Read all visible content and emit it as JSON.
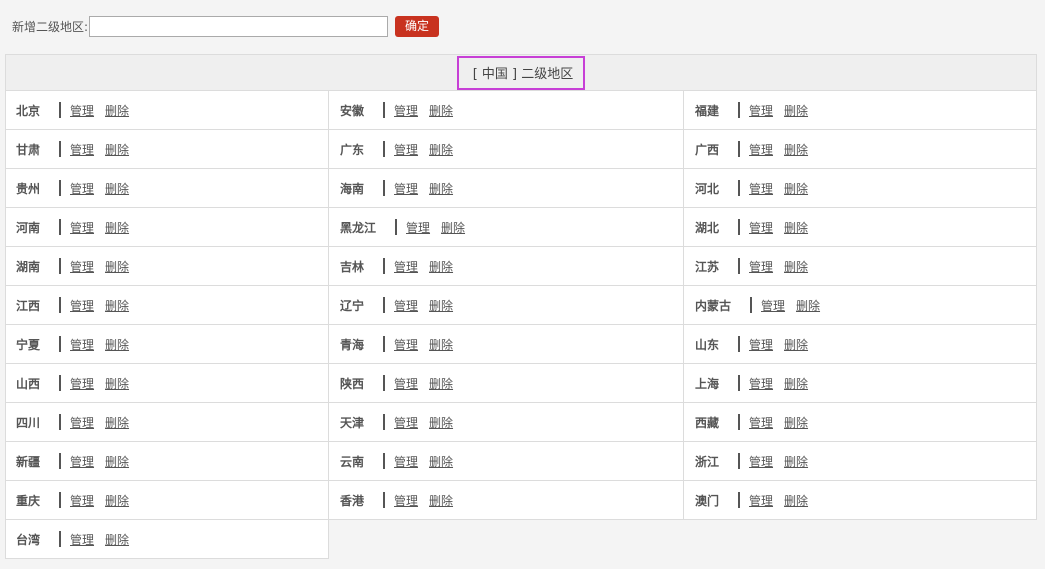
{
  "add_bar": {
    "label": "新增二级地区:",
    "input_value": "",
    "input_placeholder": "",
    "confirm_label": "确定"
  },
  "table": {
    "header": "[ 中国 ] 二级地区",
    "manage_label": "管理",
    "delete_label": "删除",
    "regions": [
      "北京",
      "安徽",
      "福建",
      "甘肃",
      "广东",
      "广西",
      "贵州",
      "海南",
      "河北",
      "河南",
      "黑龙江",
      "湖北",
      "湖南",
      "吉林",
      "江苏",
      "江西",
      "辽宁",
      "内蒙古",
      "宁夏",
      "青海",
      "山东",
      "山西",
      "陕西",
      "上海",
      "四川",
      "天津",
      "西藏",
      "新疆",
      "云南",
      "浙江",
      "重庆",
      "香港",
      "澳门",
      "台湾"
    ]
  },
  "colors": {
    "confirm_button": "#c8321f",
    "header_highlight": "#c73fd6"
  }
}
